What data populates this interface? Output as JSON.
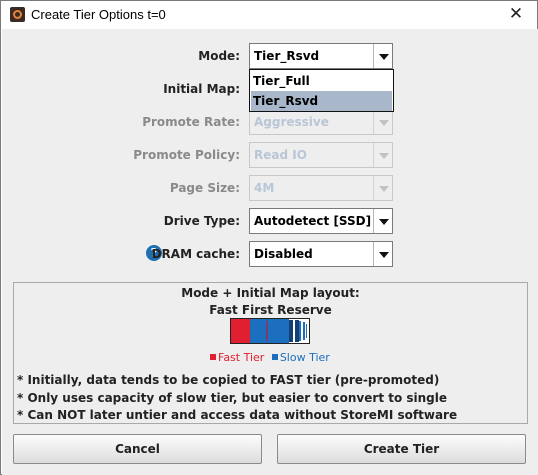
{
  "window": {
    "title": "Create Tier Options t=0"
  },
  "form": {
    "mode": {
      "label": "Mode:",
      "value": "Tier_Rsvd",
      "options": [
        "Tier_Full",
        "Tier_Rsvd"
      ],
      "selected": "Tier_Rsvd"
    },
    "initial_map": {
      "label": "Initial Map:"
    },
    "promote_rate": {
      "label": "Promote Rate:",
      "value": "Aggressive"
    },
    "promote_policy": {
      "label": "Promote Policy:",
      "value": "Read IO"
    },
    "page_size": {
      "label": "Page Size:",
      "value": "4M"
    },
    "drive_type": {
      "label": "Drive Type:",
      "value": "Autodetect [SSD]"
    },
    "dram_cache": {
      "label": "DRAM cache:",
      "value": "Disabled",
      "help_icon": "?"
    }
  },
  "layout_panel": {
    "title": "Mode + Initial Map layout:",
    "subtitle": "Fast First Reserve",
    "fill": {
      "fast": 0.24,
      "slow": 0.76
    },
    "legend": {
      "fast_label": "Fast Tier",
      "slow_label": "Slow Tier"
    },
    "notes": [
      "* Initially, data tends to be copied to FAST tier (pre-promoted)",
      "* Only uses capacity of slow tier, but easier to convert to single",
      "* Can NOT later untier and access data without StoreMI software"
    ]
  },
  "buttons": {
    "cancel": "Cancel",
    "create": "Create Tier"
  },
  "colors": {
    "fast": "#e02030",
    "slow": "#1c6fbe",
    "selected_item": "#a8b7c9"
  }
}
